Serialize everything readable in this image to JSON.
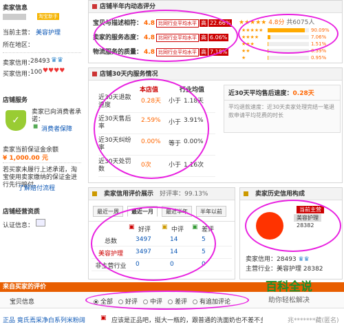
{
  "seller": {
    "header": "卖家信息",
    "badge": "淘宝新手",
    "main_label": "当前主营：",
    "main_value": "美容护理",
    "location_label": "所在地区：",
    "rating_label": "卖家信用：",
    "rating_value": "28493",
    "buyer_label": "买家信用：",
    "buyer_value": "100"
  },
  "service": {
    "header": "店铺服务",
    "promise": "卖家已向消费者承诺：",
    "protect": "消费者保障",
    "deposit_label": "卖家当前保证金余额",
    "deposit": "¥ 1,000.00 元",
    "notice": "若买家未履行上述承诺，淘宝使用卖家缴纳的保证金进行先行赔付。",
    "notice_link": "了解赔付流程"
  },
  "qualification": {
    "header": "店铺经营资质",
    "cert": "认证信息："
  },
  "dsr": {
    "header": "店铺半年内动态评分",
    "rows": [
      {
        "label": "宝贝与描述相符：",
        "score": "4.8",
        "cmp": "比同行业平均水平",
        "hi": "高",
        "pct": "22.66%"
      },
      {
        "label": "卖家的服务态度：",
        "score": "4.8",
        "cmp": "比同行业平均水平",
        "hi": "高",
        "pct": "6.06%"
      },
      {
        "label": "物流服务的质量：",
        "score": "4.8",
        "cmp": "比同行业平均水平",
        "hi": "高",
        "pct": "7.18%"
      }
    ],
    "summary_score": "4.8分",
    "summary_count": "共6075人",
    "dist": [
      {
        "stars": "★★★★★",
        "pct": "90.09%",
        "value": 90.09
      },
      {
        "stars": "★★★★",
        "pct": "7.06%",
        "value": 7.06
      },
      {
        "stars": "★★★",
        "pct": "1.51%",
        "value": 1.51
      },
      {
        "stars": "★★",
        "pct": "0.39%",
        "value": 0.39
      },
      {
        "stars": "★",
        "pct": "0.95%",
        "value": 0.95
      }
    ]
  },
  "svc30": {
    "header": "店铺30天内服务情况",
    "col_store": "本店值",
    "col_industry": "行业均值",
    "rows": [
      {
        "label": "近30天退款速度",
        "val": "0.28天",
        "cmp": "小于",
        "avg": "1.18天"
      },
      {
        "label": "近30天售后率",
        "val": "2.59%",
        "cmp": "小于",
        "avg": "3.91%"
      },
      {
        "label": "近30天纠纷率",
        "val": "0.00%",
        "cmp": "等于",
        "avg": "0.00%"
      },
      {
        "label": "近30天处罚数",
        "val": "0次",
        "cmp": "小于",
        "avg": "1.16次"
      }
    ],
    "side_title": "近30天平均售后速度：",
    "side_value": "0.28天",
    "side_desc": "平均退款速度：近30天卖家处理完结一笔退款申请平均花费的时长"
  },
  "credit": {
    "header": "卖家信用评价展示",
    "rate_label": "好评率：",
    "rate_value": "99.13%",
    "tabs": [
      "最近一周",
      "最近一月",
      "最近半年",
      "半年以前"
    ],
    "cols": [
      "好评",
      "中评",
      "差评"
    ],
    "rows": [
      {
        "label": "总数",
        "good": "3497",
        "mid": "14",
        "bad": "5"
      },
      {
        "label": "美容护理",
        "good": "3497",
        "mid": "14",
        "bad": "5"
      },
      {
        "label": "非主营行业",
        "good": "0",
        "mid": "0",
        "bad": "0"
      }
    ]
  },
  "history": {
    "header": "卖家历史信用构成",
    "legend_title": "当前主营",
    "legend_name": "美容护理",
    "legend_value": "28382",
    "seller_label": "卖家信用：",
    "seller_value": "28493",
    "main_label": "主营行业：",
    "main_value": "美容护理",
    "main_count": "28382",
    "chart_data": {
      "type": "pie",
      "categories": [
        "美容护理"
      ],
      "values": [
        28382
      ]
    }
  },
  "reviews": {
    "header": "来自买家的评价",
    "col_item": "宝贝信息",
    "filters": [
      "全部",
      "好评",
      "中评",
      "差评",
      "有追加评论"
    ],
    "row_item": "正品 竟氏焉采净白系列米粉阔",
    "row_comment": "应该是正品吧，挺大一瓶的，跟普通的洗面奶也不差不多，就是太",
    "row_user": "兆*******藏(匿名)"
  },
  "watermark": {
    "main": "百科全说",
    "sub": "助你轻松解决"
  },
  "colors": {
    "accent": "#c00000",
    "oval": "#e81fe0",
    "pie": "#ff3300"
  }
}
